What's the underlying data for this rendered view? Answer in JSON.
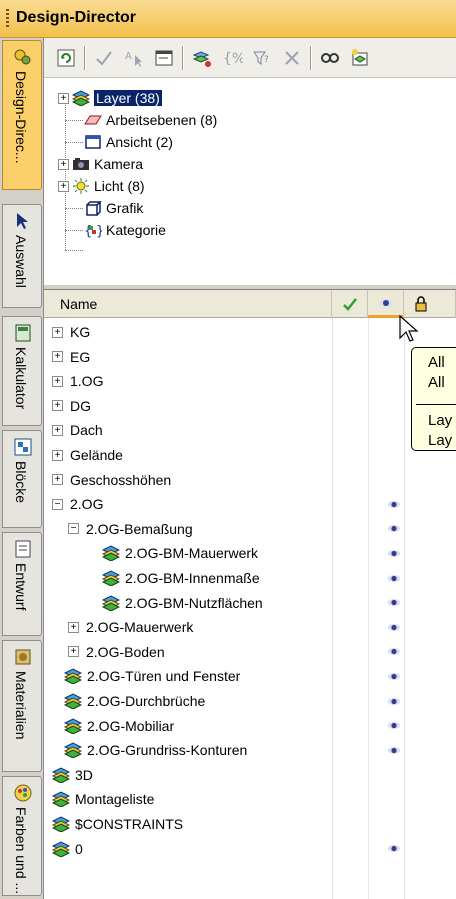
{
  "window": {
    "title": "Design-Director"
  },
  "tabs": [
    {
      "label": "Design-Direc...",
      "icon": "design-director-icon",
      "active": true
    },
    {
      "label": "Auswahl",
      "icon": "cursor-icon",
      "active": false
    },
    {
      "label": "Kalkulator",
      "icon": "calculator-icon",
      "active": false
    },
    {
      "label": "Blöcke",
      "icon": "blocks-icon",
      "active": false
    },
    {
      "label": "Entwurf",
      "icon": "draft-icon",
      "active": false
    },
    {
      "label": "Materialien",
      "icon": "materials-icon",
      "active": false
    },
    {
      "label": "Farben und ...",
      "icon": "colors-icon",
      "active": false
    }
  ],
  "toolbar": {
    "buttons": [
      "refresh-icon",
      "check-icon",
      "select-icon",
      "properties-icon",
      "layer-group-icon",
      "brackets-icon",
      "filter-icon",
      "delete-icon",
      "search-icon",
      "layer-new-icon"
    ]
  },
  "tree": {
    "items": [
      {
        "label": "Layer (38)",
        "icon": "layer-stack-icon",
        "expander": "+",
        "selected": true
      },
      {
        "label": "Arbeitsebenen (8)",
        "icon": "workplane-icon",
        "expander": "",
        "selected": false
      },
      {
        "label": "Ansicht (2)",
        "icon": "view-icon",
        "expander": "",
        "selected": false
      },
      {
        "label": "Kamera",
        "icon": "camera-icon",
        "expander": "+",
        "selected": false
      },
      {
        "label": "Licht (8)",
        "icon": "light-icon",
        "expander": "+",
        "selected": false
      },
      {
        "label": "Grafik",
        "icon": "graphic-icon",
        "expander": "",
        "selected": false
      },
      {
        "label": "Kategorie",
        "icon": "category-icon",
        "expander": "",
        "selected": false
      }
    ]
  },
  "grid": {
    "columns": {
      "name": "Name"
    },
    "rows": [
      {
        "label": "KG",
        "indent": 0,
        "expander": "+",
        "icon": "",
        "eye": false
      },
      {
        "label": "EG",
        "indent": 0,
        "expander": "+",
        "icon": "",
        "eye": false
      },
      {
        "label": "1.OG",
        "indent": 0,
        "expander": "+",
        "icon": "",
        "eye": false
      },
      {
        "label": "DG",
        "indent": 0,
        "expander": "+",
        "icon": "",
        "eye": false
      },
      {
        "label": "Dach",
        "indent": 0,
        "expander": "+",
        "icon": "",
        "eye": false
      },
      {
        "label": "Gelände",
        "indent": 0,
        "expander": "+",
        "icon": "",
        "eye": false
      },
      {
        "label": "Geschosshöhen",
        "indent": 0,
        "expander": "+",
        "icon": "",
        "eye": false
      },
      {
        "label": "2.OG",
        "indent": 0,
        "expander": "−",
        "icon": "",
        "eye": true
      },
      {
        "label": "2.OG-Bemaßung",
        "indent": 1,
        "expander": "−",
        "icon": "",
        "eye": true
      },
      {
        "label": "2.OG-BM-Mauerwerk",
        "indent": 2,
        "expander": "",
        "icon": "layer",
        "eye": true
      },
      {
        "label": "2.OG-BM-Innenmaße",
        "indent": 2,
        "expander": "",
        "icon": "layer",
        "eye": true
      },
      {
        "label": "2.OG-BM-Nutzflächen",
        "indent": 2,
        "expander": "",
        "icon": "layer",
        "eye": true
      },
      {
        "label": "2.OG-Mauerwerk",
        "indent": 1,
        "expander": "+",
        "icon": "",
        "eye": true
      },
      {
        "label": "2.OG-Boden",
        "indent": 1,
        "expander": "+",
        "icon": "",
        "eye": true
      },
      {
        "label": "2.OG-Türen und Fenster",
        "indent": 1,
        "expander": "",
        "icon": "layer",
        "eye": true
      },
      {
        "label": "2.OG-Durchbrüche",
        "indent": 1,
        "expander": "",
        "icon": "layer",
        "eye": true
      },
      {
        "label": "2.OG-Mobiliar",
        "indent": 1,
        "expander": "",
        "icon": "layer",
        "eye": true
      },
      {
        "label": "2.OG-Grundriss-Konturen",
        "indent": 1,
        "expander": "",
        "icon": "layer",
        "eye": true
      },
      {
        "label": "3D",
        "indent": 0,
        "expander": "",
        "icon": "layer",
        "eye": false
      },
      {
        "label": "Montageliste",
        "indent": 0,
        "expander": "",
        "icon": "layer",
        "eye": false
      },
      {
        "label": "$CONSTRAINTS",
        "indent": 0,
        "expander": "",
        "icon": "layer",
        "eye": false
      },
      {
        "label": "0",
        "indent": 0,
        "expander": "",
        "icon": "layer",
        "eye": true
      }
    ]
  },
  "tooltip": {
    "lines": [
      "All",
      "All",
      "Lay",
      "Lay"
    ]
  },
  "colors": {
    "accent": "#fbd06a",
    "selection": "#0a246a",
    "eye": "#2f3f8f"
  }
}
